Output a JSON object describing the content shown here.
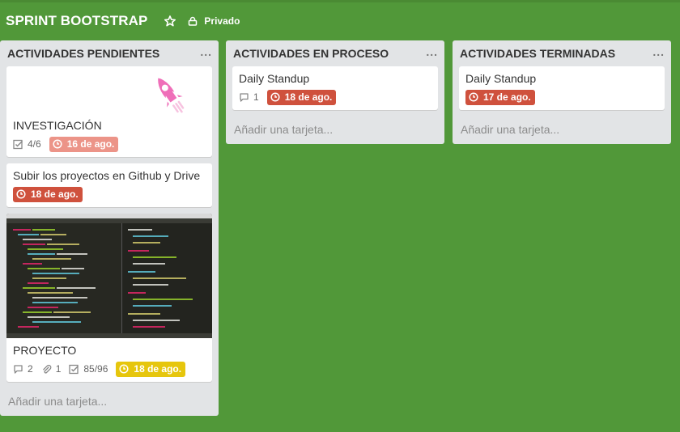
{
  "board": {
    "title": "SPRINT BOOTSTRAP",
    "privacy_label": "Privado"
  },
  "colors": {
    "board_bg": "#519839",
    "list_bg": "#e2e4e6",
    "due_red": "#cf513d",
    "due_pink": "#ec9488",
    "due_yellow": "#e6c60d"
  },
  "lists": [
    {
      "title": "ACTIVIDADES PENDIENTES",
      "menu": "...",
      "add_card": "Añadir una tarjeta...",
      "cards": [
        {
          "title": "INVESTIGACIÓN",
          "checklist": "4/6",
          "due": "16 de ago.",
          "cover": "rocket-sticker"
        },
        {
          "title": "Subir los proyectos en Github y Drive",
          "due": "18 de ago."
        },
        {
          "title": "PROYECTO",
          "comments": "2",
          "attachments": "1",
          "checklist": "85/96",
          "due": "18 de ago.",
          "cover": "code-editor-screenshot"
        }
      ]
    },
    {
      "title": "ACTIVIDADES EN PROCESO",
      "menu": "...",
      "add_card": "Añadir una tarjeta...",
      "cards": [
        {
          "title": "Daily Standup",
          "comments": "1",
          "due": "18 de ago."
        }
      ]
    },
    {
      "title": "ACTIVIDADES TERMINADAS",
      "menu": "...",
      "add_card": "Añadir una tarjeta...",
      "cards": [
        {
          "title": "Daily Standup",
          "due": "17 de ago."
        }
      ]
    }
  ]
}
